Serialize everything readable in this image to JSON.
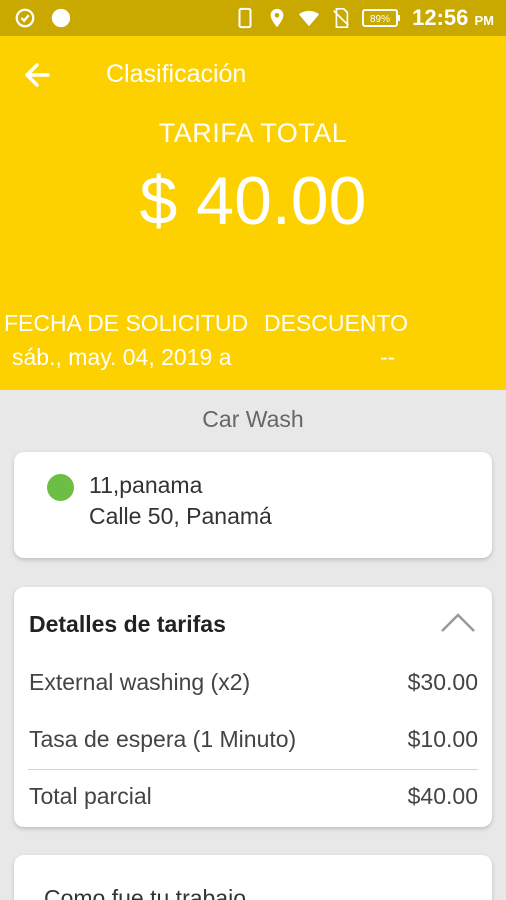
{
  "status_bar": {
    "time": "12:56",
    "ampm": "PM",
    "battery": "89%",
    "icons": [
      "cast-icon",
      "circle-icon",
      "phone-icon",
      "location-icon",
      "wifi-icon",
      "no-sim-icon",
      "battery-icon"
    ]
  },
  "header": {
    "title": "Clasificación",
    "fare_label": "TARIFA TOTAL",
    "fare_amount": "$ 40.00",
    "request_date_label": "FECHA DE SOLICITUD",
    "request_date_value": "sáb., may. 04, 2019 a",
    "discount_label": "DESCUENTO",
    "discount_value": "--"
  },
  "service_name": "Car Wash",
  "address": {
    "line1": "11,panama",
    "line2": "Calle 50, Panamá"
  },
  "fare_details": {
    "title": "Detalles de tarifas",
    "items": [
      {
        "label": "External washing (x2)",
        "value": "$30.00"
      },
      {
        "label": "Tasa de espera (1 Minuto)",
        "value": "$10.00"
      }
    ],
    "subtotal_label": "Total parcial",
    "subtotal_value": "$40.00"
  },
  "rating": {
    "prompt": "Como fue tu trabajo"
  },
  "colors": {
    "header_bg": "#fdd000",
    "status_bg": "#c9a800",
    "dot_green": "#6cbe45"
  }
}
